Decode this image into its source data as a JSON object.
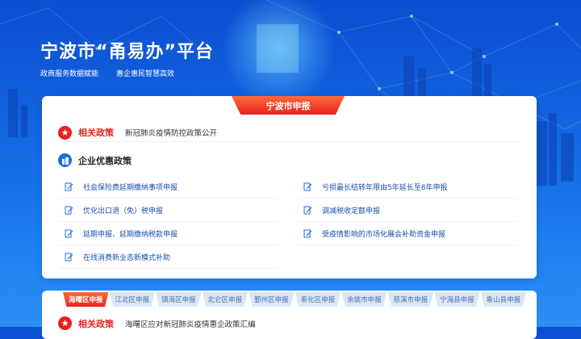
{
  "hero": {
    "title": "宁波市“甬易办”平台",
    "sub1": "政商服务数据赋能",
    "sub2": "惠企惠民智慧高效"
  },
  "main_card": {
    "tab_label": "宁波市申报",
    "policy_label": "相关政策",
    "policy_text": "新冠肺炎疫情防控政策公开",
    "section_title": "企业优惠政策",
    "left_items": [
      "社会保险费延期缴纳事项申报",
      "优化出口退（免）税申报",
      "延期申报、延期缴纳税款申报",
      "在线消费新业态新模式补助"
    ],
    "right_items": [
      "亏损最长结转年限由5年延长至8年申报",
      "调减税收定额申报",
      "受疫情影响的市场化展会补助资金申报"
    ]
  },
  "district_tabs": [
    "海曙区申报",
    "江北区申报",
    "镇海区申报",
    "北仑区申报",
    "鄞州区申报",
    "奉化区申报",
    "余姚市申报",
    "慈溪市申报",
    "宁海县申报",
    "象山县申报"
  ],
  "second_card": {
    "policy_label": "相关政策",
    "policy_text": "海曙区应对新冠肺炎疫情惠企政策汇编"
  },
  "colors": {
    "accent_red": "#e8231f",
    "brand_blue": "#1a6fe0",
    "link_blue": "#1a4fa8"
  }
}
